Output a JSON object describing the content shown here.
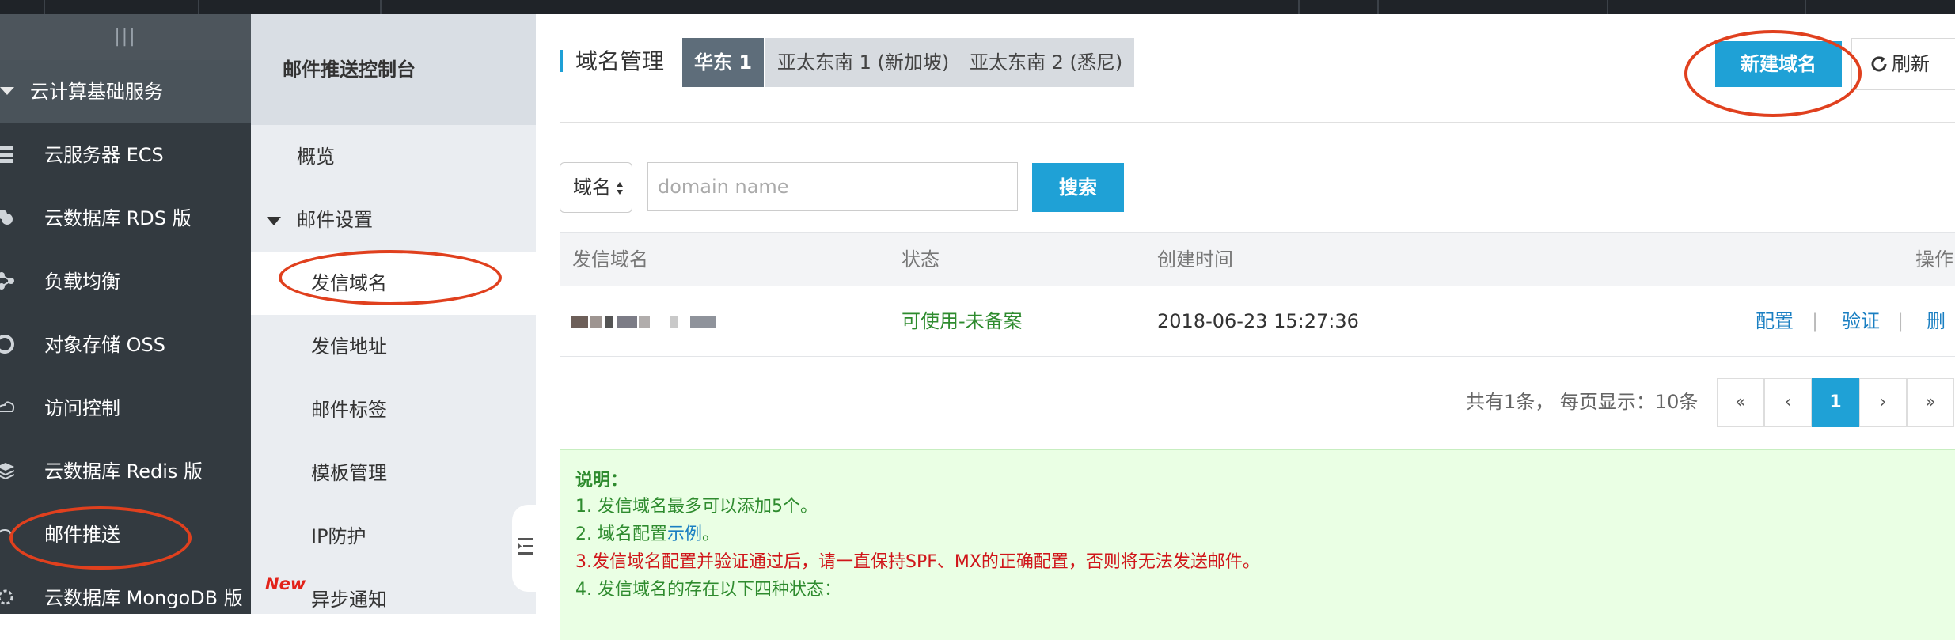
{
  "sidebar": {
    "collapse_icon": "|||",
    "group_label": "云计算基础服务",
    "items": [
      {
        "label": "云服务器 ECS",
        "icon": "server-icon"
      },
      {
        "label": "云数据库 RDS 版",
        "icon": "database-icon"
      },
      {
        "label": "负载均衡",
        "icon": "load-balancer-icon"
      },
      {
        "label": "对象存储 OSS",
        "icon": "storage-icon"
      },
      {
        "label": "访问控制",
        "icon": "access-control-icon"
      },
      {
        "label": "云数据库 Redis 版",
        "icon": "redis-icon"
      },
      {
        "label": "邮件推送",
        "icon": "mail-icon"
      },
      {
        "label": "云数据库 MongoDB 版",
        "icon": "mongodb-icon"
      }
    ]
  },
  "submenu": {
    "title": "邮件推送控制台",
    "overview": "概览",
    "group_label": "邮件设置",
    "items": [
      "发信域名",
      "发信地址",
      "邮件标签",
      "模板管理",
      "IP防护",
      "异步通知"
    ],
    "new_badge": "New"
  },
  "main": {
    "title": "域名管理",
    "region_tabs": [
      {
        "label": "华东 1",
        "active": true
      },
      {
        "label": "亚太东南 1 (新加坡)",
        "active": false
      },
      {
        "label": "亚太东南 2 (悉尼)",
        "active": false
      }
    ],
    "new_domain_button": "新建域名",
    "refresh_button": "刷新",
    "search": {
      "select_value": "域名",
      "placeholder": "domain name",
      "button": "搜索"
    },
    "table": {
      "headers": [
        "发信域名",
        "状态",
        "创建时间",
        "操作"
      ],
      "rows": [
        {
          "domain": "",
          "status": "可使用-未备案",
          "created": "2018-06-23 15:27:36",
          "actions": [
            "配置",
            "验证",
            "删除"
          ]
        }
      ]
    },
    "pagination": {
      "summary": "共有1条， 每页显示：10条",
      "first": "«",
      "prev": "‹",
      "current": "1",
      "next": "›",
      "last": "»"
    },
    "notice": {
      "title": "说明：",
      "line1": "1. 发信域名最多可以添加5个。",
      "line2_prefix": "2. 域名配置",
      "line2_link": "示例",
      "line2_suffix": "。",
      "line3": "3.发信域名配置并验证通过后，请一直保持SPF、MX的正确配置，否则将无法发送邮件。",
      "line4": "4. 发信域名的存在以下四种状态："
    }
  },
  "colors": {
    "accent": "#1fa1d6",
    "sidebar_bg": "#333a40",
    "status_ok": "#2e8b2e",
    "warning": "#d0161a",
    "annotation": "#e0401e"
  }
}
